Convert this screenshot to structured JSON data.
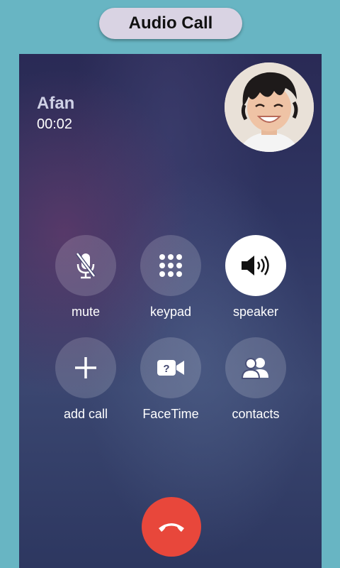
{
  "header": {
    "title": "Audio Call"
  },
  "call": {
    "caller_name": "Afan",
    "duration": "00:02"
  },
  "controls": [
    {
      "label": "mute",
      "icon": "mic-off-icon",
      "active": false
    },
    {
      "label": "keypad",
      "icon": "keypad-icon",
      "active": false
    },
    {
      "label": "speaker",
      "icon": "speaker-icon",
      "active": true
    },
    {
      "label": "add call",
      "icon": "plus-icon",
      "active": false
    },
    {
      "label": "FaceTime",
      "icon": "video-camera-icon",
      "active": false
    },
    {
      "label": "contacts",
      "icon": "contacts-icon",
      "active": false
    }
  ],
  "end_call": {
    "icon": "phone-hangup-icon",
    "color": "#e8473b"
  },
  "colors": {
    "outer_background": "#68b5c3",
    "title_pill": "#d9d3e3"
  }
}
